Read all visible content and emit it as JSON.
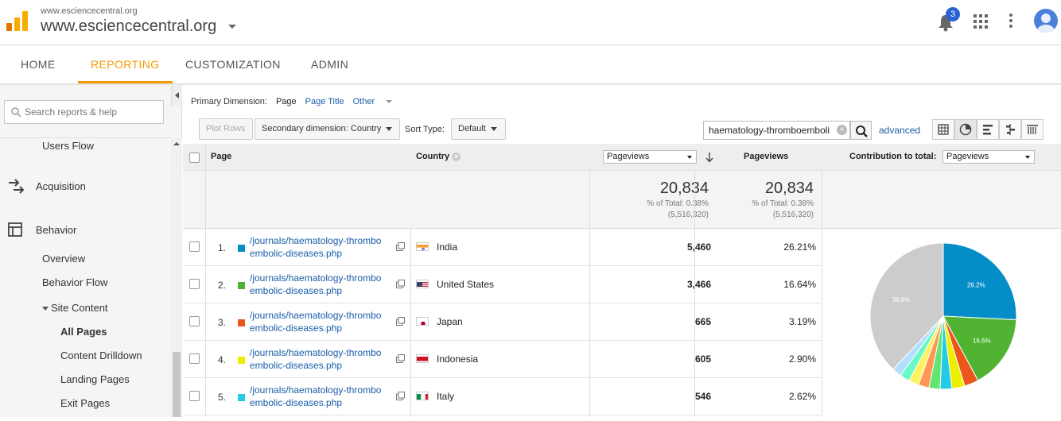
{
  "header": {
    "account_small": "www.esciencecentral.org",
    "property_name": "www.esciencecentral.org",
    "notification_count": "3"
  },
  "nav": {
    "tabs": [
      "Home",
      "Reporting",
      "Customization",
      "Admin"
    ],
    "active": "Reporting"
  },
  "sidebar": {
    "search_placeholder": "Search reports & help",
    "items": {
      "users_flow": "Users Flow",
      "acquisition": "Acquisition",
      "behavior": "Behavior",
      "overview": "Overview",
      "behavior_flow": "Behavior Flow",
      "site_content": "Site Content",
      "all_pages": "All Pages",
      "content_drilldown": "Content Drilldown",
      "landing_pages": "Landing Pages",
      "exit_pages": "Exit Pages"
    }
  },
  "report": {
    "primary_dimension_label": "Primary Dimension:",
    "dimension_page": "Page",
    "dimension_page_title": "Page Title",
    "dimension_other": "Other",
    "plot_rows": "Plot Rows",
    "secondary_dimension": "Secondary dimension: Country",
    "sort_type_label": "Sort Type:",
    "sort_type_value": "Default",
    "filter_value": "haematology-thromboemboli",
    "advanced": "advanced"
  },
  "table": {
    "headers": {
      "page": "Page",
      "country": "Country",
      "metric_select": "Pageviews",
      "pageviews": "Pageviews",
      "contribution_label": "Contribution to total:",
      "contribution_select": "Pageviews"
    },
    "totals": {
      "value1": "20,834",
      "pct1": "% of Total: 0.38%",
      "of1": "(5,516,320)",
      "value2": "20,834",
      "pct2": "% of Total: 0.38%",
      "of2": "(5,516,320)"
    },
    "rows": [
      {
        "rank": "1.",
        "page_line1": "/journals/haematology-thrombo",
        "page_line2": "embolic-diseases.php",
        "country": "India",
        "pageviews": "5,460",
        "pct": "26.21%",
        "color": "#058dc7"
      },
      {
        "rank": "2.",
        "page_line1": "/journals/haematology-thrombo",
        "page_line2": "embolic-diseases.php",
        "country": "United States",
        "pageviews": "3,466",
        "pct": "16.64%",
        "color": "#50b432"
      },
      {
        "rank": "3.",
        "page_line1": "/journals/haematology-thrombo",
        "page_line2": "embolic-diseases.php",
        "country": "Japan",
        "pageviews": "665",
        "pct": "3.19%",
        "color": "#ed561b"
      },
      {
        "rank": "4.",
        "page_line1": "/journals/haematology-thrombo",
        "page_line2": "embolic-diseases.php",
        "country": "Indonesia",
        "pageviews": "605",
        "pct": "2.90%",
        "color": "#edef00"
      },
      {
        "rank": "5.",
        "page_line1": "/journals/haematology-thrombo",
        "page_line2": "embolic-diseases.php",
        "country": "Italy",
        "pageviews": "546",
        "pct": "2.62%",
        "color": "#24cbe5"
      }
    ]
  },
  "chart_data": {
    "type": "pie",
    "slices": [
      {
        "value": 26.2,
        "color": "#058dc7",
        "label": "26.2%"
      },
      {
        "value": 16.6,
        "color": "#50b432",
        "label": "16.6%"
      },
      {
        "value": 3.19,
        "color": "#ed561b",
        "label": ""
      },
      {
        "value": 2.9,
        "color": "#edef00",
        "label": ""
      },
      {
        "value": 2.62,
        "color": "#24cbe5",
        "label": ""
      },
      {
        "value": 2.5,
        "color": "#64e572",
        "label": ""
      },
      {
        "value": 2.4,
        "color": "#ff9655",
        "label": ""
      },
      {
        "value": 2.3,
        "color": "#fff263",
        "label": ""
      },
      {
        "value": 2.2,
        "color": "#6af9c4",
        "label": ""
      },
      {
        "value": 2.1,
        "color": "#b2deff",
        "label": ""
      },
      {
        "value": 38.6,
        "color": "#cccccc",
        "label": "38.6%"
      }
    ]
  }
}
